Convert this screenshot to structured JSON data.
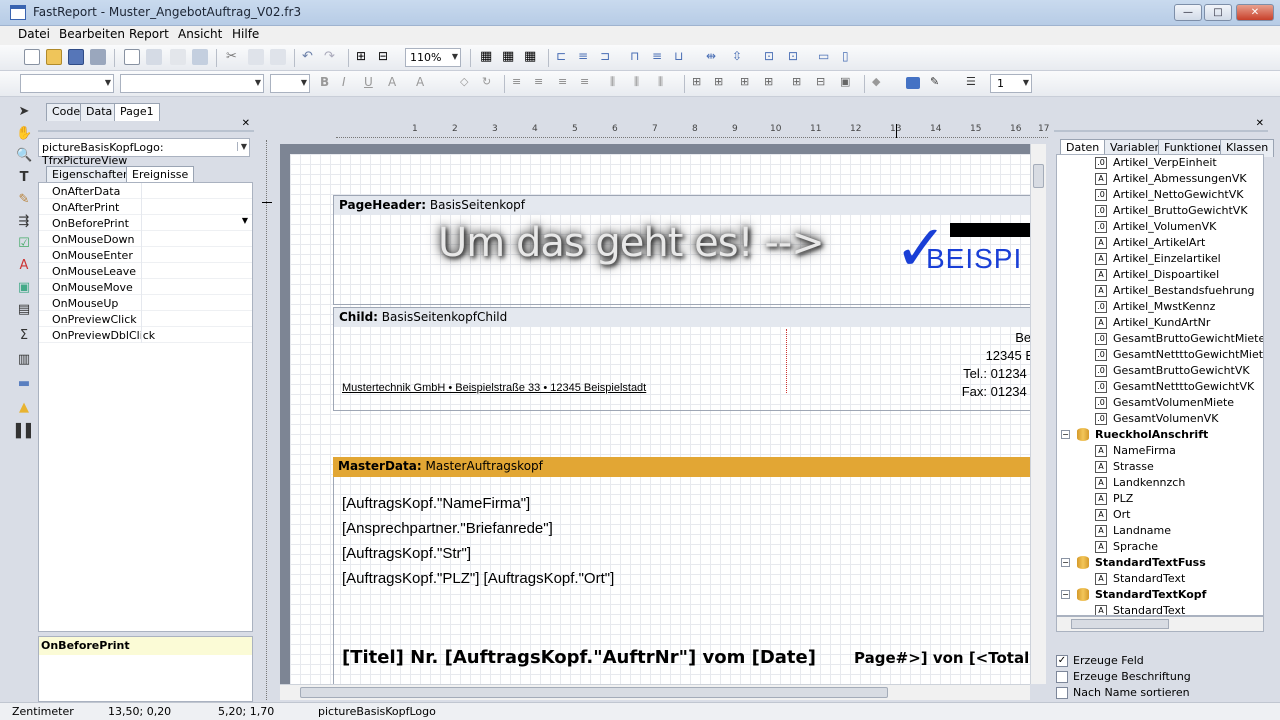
{
  "window": {
    "title": "FastReport - Muster_AngebotAuftrag_V02.fr3"
  },
  "menu": [
    "Datei",
    "Bearbeiten",
    "Report",
    "Ansicht",
    "Hilfe"
  ],
  "toolbar": {
    "zoom": "110%",
    "line_width": "1"
  },
  "page_tabs": [
    "Code",
    "Data",
    "Page1"
  ],
  "inspector": {
    "object_selector": "pictureBasisKopfLogo: TfrxPictureView",
    "tabs": [
      "Eigenschaften",
      "Ereignisse"
    ],
    "events": [
      "OnAfterData",
      "OnAfterPrint",
      "OnBeforePrint",
      "OnMouseDown",
      "OnMouseEnter",
      "OnMouseLeave",
      "OnMouseMove",
      "OnMouseUp",
      "OnPreviewClick",
      "OnPreviewDblClick"
    ],
    "selected_event_description": "OnBeforePrint"
  },
  "ruler": {
    "marks": [
      "1",
      "2",
      "3",
      "4",
      "5",
      "6",
      "7",
      "8",
      "9",
      "10",
      "11",
      "12",
      "13",
      "14",
      "15",
      "16",
      "17"
    ]
  },
  "report": {
    "page_header": {
      "type": "PageHeader:",
      "name": "BasisSeitenkopf",
      "logo_text": "BEISPI"
    },
    "child": {
      "type": "Child:",
      "name": "BasisSeitenkopfChild",
      "address_line": "Mustertechnik GmbH • Beispielstraße 33 • 12345 Beispielstadt",
      "right_lines": [
        "Bei",
        "12345 B",
        "Tel.: 01234 /",
        "Fax: 01234 /"
      ]
    },
    "master": {
      "type": "MasterData:",
      "name": "MasterAuftragskopf",
      "fields": [
        "[AuftragsKopf.\"NameFirma\"]",
        "[Ansprechpartner.\"Briefanrede\"]",
        "[AuftragsKopf.\"Str\"]",
        "[AuftragsKopf.\"PLZ\"] [AuftragsKopf.\"Ort\"]"
      ],
      "title": "[Titel] Nr. [AuftragsKopf.\"AuftrNr\"] vom [Date]",
      "page_of": "Page#>] von [<Total"
    }
  },
  "overlay_text": "Um das geht es! -->",
  "right_panel": {
    "tabs": [
      "Daten",
      "Variablen",
      "Funktionen",
      "Klassen"
    ],
    "tree": [
      {
        "label": "Artikel_VerpEinheit",
        "kind": "num",
        "level": 2
      },
      {
        "label": "Artikel_AbmessungenVK",
        "kind": "text",
        "level": 2
      },
      {
        "label": "Artikel_NettoGewichtVK",
        "kind": "num",
        "level": 2
      },
      {
        "label": "Artikel_BruttoGewichtVK",
        "kind": "num",
        "level": 2
      },
      {
        "label": "Artikel_VolumenVK",
        "kind": "num",
        "level": 2
      },
      {
        "label": "Artikel_ArtikelArt",
        "kind": "text",
        "level": 2
      },
      {
        "label": "Artikel_Einzelartikel",
        "kind": "text",
        "level": 2
      },
      {
        "label": "Artikel_Dispoartikel",
        "kind": "text",
        "level": 2
      },
      {
        "label": "Artikel_Bestandsfuehrung",
        "kind": "text",
        "level": 2
      },
      {
        "label": "Artikel_MwstKennz",
        "kind": "num",
        "level": 2
      },
      {
        "label": "Artikel_KundArtNr",
        "kind": "text",
        "level": 2
      },
      {
        "label": "GesamtBruttoGewichtMiete",
        "kind": "num",
        "level": 2
      },
      {
        "label": "GesamtNettttoGewichtMiete",
        "kind": "num",
        "level": 2
      },
      {
        "label": "GesamtBruttoGewichtVK",
        "kind": "num",
        "level": 2
      },
      {
        "label": "GesamtNettttoGewichtVK",
        "kind": "num",
        "level": 2
      },
      {
        "label": "GesamtVolumenMiete",
        "kind": "num",
        "level": 2
      },
      {
        "label": "GesamtVolumenVK",
        "kind": "num",
        "level": 2
      },
      {
        "label": "RueckholAnschrift",
        "kind": "db",
        "level": 1
      },
      {
        "label": "NameFirma",
        "kind": "text",
        "level": 2
      },
      {
        "label": "Strasse",
        "kind": "text",
        "level": 2
      },
      {
        "label": "Landkennzch",
        "kind": "text",
        "level": 2
      },
      {
        "label": "PLZ",
        "kind": "text",
        "level": 2
      },
      {
        "label": "Ort",
        "kind": "text",
        "level": 2
      },
      {
        "label": "Landname",
        "kind": "text",
        "level": 2
      },
      {
        "label": "Sprache",
        "kind": "text",
        "level": 2
      },
      {
        "label": "StandardTextFuss",
        "kind": "db",
        "level": 1
      },
      {
        "label": "StandardText",
        "kind": "text",
        "level": 2
      },
      {
        "label": "StandardTextKopf",
        "kind": "db",
        "level": 1
      },
      {
        "label": "StandardText",
        "kind": "text",
        "level": 2
      }
    ],
    "options": [
      {
        "label": "Erzeuge Feld",
        "checked": true
      },
      {
        "label": "Erzeuge Beschriftung",
        "checked": false
      },
      {
        "label": "Nach Name sortieren",
        "checked": false
      }
    ]
  },
  "status": {
    "unit": "Zentimeter",
    "position": "13,50; 0,20",
    "size": "5,20; 1,70",
    "object": "pictureBasisKopfLogo"
  },
  "colors": {
    "master_band": "#e2a634",
    "title_bg": "#bfd2ea"
  }
}
